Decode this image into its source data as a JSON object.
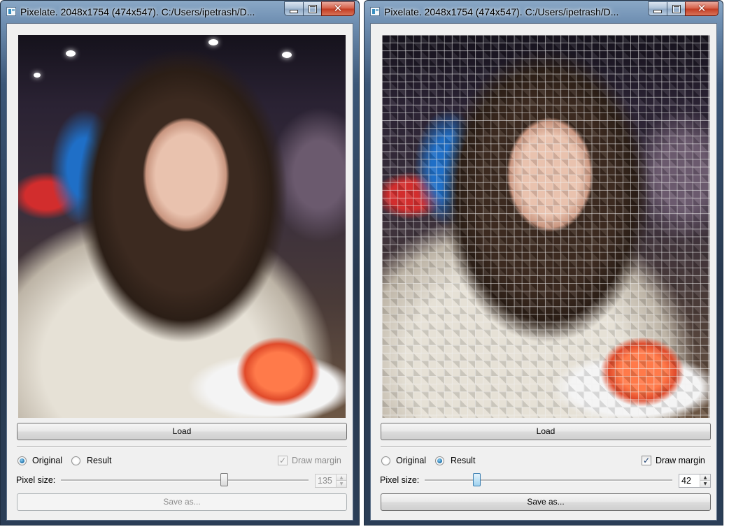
{
  "windows": [
    {
      "title": "Pixelate. 2048x1754 (474x547). C:/Users/ipetrash/D...",
      "load_label": "Load",
      "mode": "original",
      "radio_original_label": "Original",
      "radio_result_label": "Result",
      "draw_margin_label": "Draw margin",
      "draw_margin_checked": true,
      "draw_margin_enabled": false,
      "pixel_size_label": "Pixel size:",
      "pixel_size": "135",
      "pixel_size_enabled": false,
      "save_label": "Save as...",
      "save_enabled": false,
      "close_glyph": "✕",
      "check_glyph": "✓",
      "spin_up_glyph": "▲",
      "spin_down_glyph": "▼"
    },
    {
      "title": "Pixelate. 2048x1754 (474x547). C:/Users/ipetrash/D...",
      "load_label": "Load",
      "mode": "result",
      "radio_original_label": "Original",
      "radio_result_label": "Result",
      "draw_margin_label": "Draw margin",
      "draw_margin_checked": true,
      "draw_margin_enabled": true,
      "pixel_size_label": "Pixel size:",
      "pixel_size": "42",
      "pixel_size_enabled": true,
      "save_label": "Save as...",
      "save_enabled": true,
      "close_glyph": "✕",
      "check_glyph": "✓",
      "spin_up_glyph": "▲",
      "spin_down_glyph": "▼"
    }
  ],
  "slider_fraction": {
    "left": 0.66,
    "right": 0.21
  },
  "colors": {
    "accent": "#1d6fa8",
    "close_button": "#c23b22",
    "macaron": "#ff7a4a"
  }
}
